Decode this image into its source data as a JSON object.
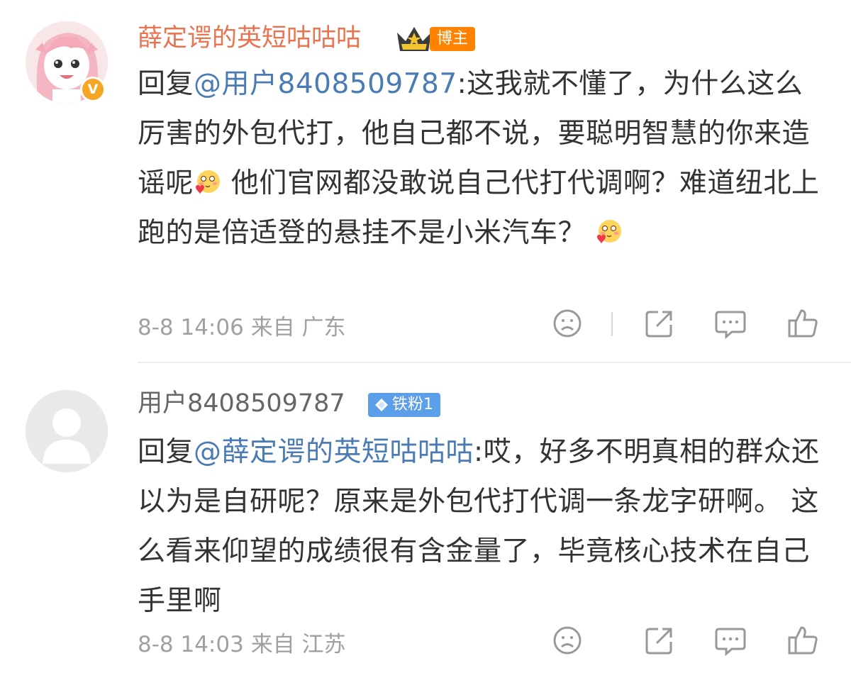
{
  "comments": [
    {
      "username": "薛定谔的英短咕咕咕",
      "badge": "博主",
      "reply_prefix": "回复",
      "mention": "@用户8408509787",
      "text_part1": ":这我就不懂了，为什么这么厉害的外包代打，他自己都不说，要聪明智慧的你来造谣呢",
      "text_part2": " 他们官网都没敢说自己代打代调啊？难道纽北上跑的是倍适登的悬挂不是小米汽车？",
      "time": "8-8 14:06",
      "location_prefix": "来自",
      "location": "广东"
    },
    {
      "username": "用户8408509787",
      "badge": "铁粉1",
      "reply_prefix": "回复",
      "mention": "@薛定谔的英短咕咕咕",
      "text": ":哎，好多不明真相的群众还以为是自研呢？原来是外包代打代调一条龙字研啊。 这么看来仰望的成绩很有含金量了，毕竟核心技术在自己手里啊",
      "time": "8-8 14:03",
      "location_prefix": "来自",
      "location": "江苏"
    }
  ],
  "colors": {
    "blogger_name": "#eb7350",
    "mention": "#4a7bb5",
    "blogger_badge": "#ff8200",
    "fan_badge": "#5b9eea"
  },
  "icons": [
    "dislike-face-icon",
    "share-icon",
    "comment-icon",
    "like-thumb-icon",
    "crown-icon",
    "diamond-icon",
    "blush-emoji-icon",
    "verified-v-icon"
  ]
}
